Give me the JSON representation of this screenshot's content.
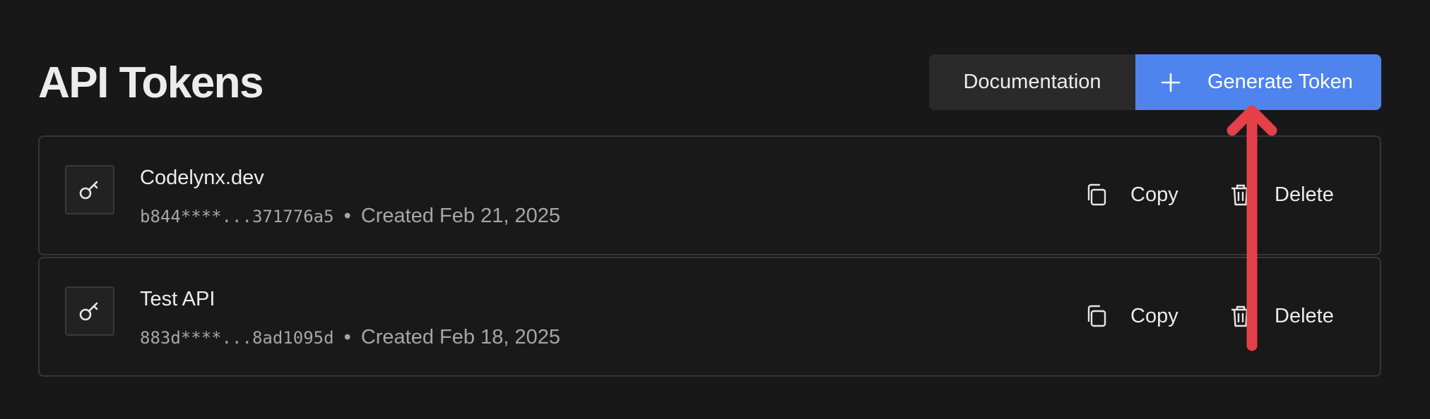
{
  "page": {
    "title": "API Tokens"
  },
  "toolbar": {
    "documentation_label": "Documentation",
    "generate_label": "Generate Token"
  },
  "tokens": [
    {
      "name": "Codelynx.dev",
      "masked_key": "b844****...371776a5",
      "separator": "•",
      "created": "Created Feb 21, 2025",
      "copy_label": "Copy",
      "delete_label": "Delete"
    },
    {
      "name": "Test API",
      "masked_key": "883d****...8ad1095d",
      "separator": "•",
      "created": "Created Feb 18, 2025",
      "copy_label": "Copy",
      "delete_label": "Delete"
    }
  ],
  "colors": {
    "background": "#181818",
    "primary": "#4f83ee",
    "annotation_arrow": "#e5404a"
  },
  "icons": {
    "add": "plus-icon",
    "key": "key-icon",
    "copy": "copy-icon",
    "delete": "trash-icon"
  }
}
